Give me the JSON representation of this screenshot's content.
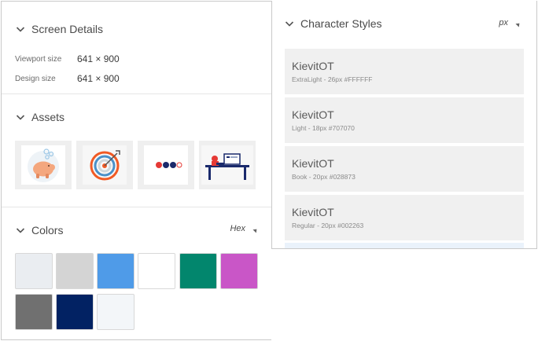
{
  "screen_details": {
    "title": "Screen Details",
    "viewport_label": "Viewport size",
    "viewport_value": "641 × 900",
    "design_label": "Design size",
    "design_value": "641 × 900"
  },
  "assets": {
    "title": "Assets",
    "items": [
      {
        "icon": "piggy-bank-icon"
      },
      {
        "icon": "target-icon"
      },
      {
        "icon": "dots-icon"
      },
      {
        "icon": "desk-scene-icon"
      }
    ]
  },
  "colors": {
    "title": "Colors",
    "format_label": "Hex",
    "swatches": [
      "#eaedf1",
      "#d4d4d4",
      "#4f9be8",
      "#ffffff",
      "#02866d",
      "#c956c7",
      "#707070",
      "#022263",
      "#f3f6f9"
    ]
  },
  "character_styles": {
    "title": "Character Styles",
    "unit_label": "px",
    "items": [
      {
        "name": "KievitOT",
        "meta": "ExtraLight - 26px #FFFFFF"
      },
      {
        "name": "KievitOT",
        "meta": "Light - 18px #707070"
      },
      {
        "name": "KievitOT",
        "meta": "Book - 20px #028873"
      },
      {
        "name": "KievitOT",
        "meta": "Regular - 20px #002263"
      }
    ]
  }
}
